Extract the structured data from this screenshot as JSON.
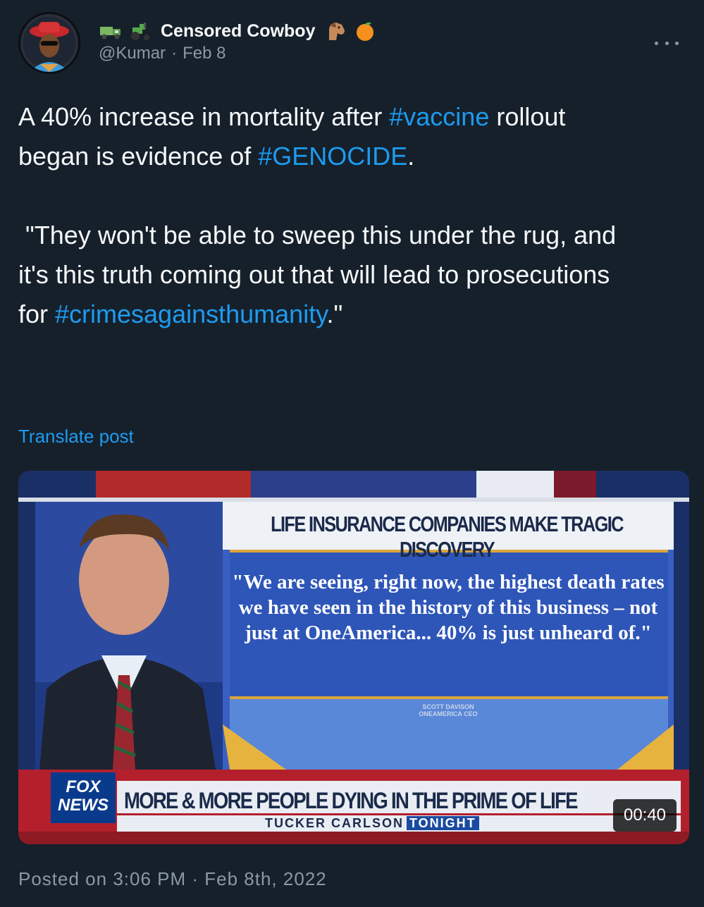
{
  "author": {
    "display_name": "Censored Cowboy",
    "handle": "@Kumar",
    "date": "Feb 8",
    "separator": "·",
    "name_emojis_left": [
      "truck-emoji",
      "tractor-emoji"
    ],
    "name_emojis_right": [
      "horse-face-emoji",
      "tangerine-emoji"
    ]
  },
  "tweet": {
    "segments": [
      {
        "text": "A 40% increase in mortality after ",
        "type": "text"
      },
      {
        "text": "#vaccine",
        "type": "hashtag"
      },
      {
        "text": " rollout\nbegan is evidence of ",
        "type": "text"
      },
      {
        "text": "#GENOCIDE",
        "type": "hashtag"
      },
      {
        "text": ".\n\n \"They won't be able to sweep this under the rug, and\nit's this truth coming out that will lead to prosecutions\nfor ",
        "type": "text"
      },
      {
        "text": "#crimesagainsthumanity",
        "type": "hashtag"
      },
      {
        "text": ".\"",
        "type": "text"
      }
    ],
    "translate_label": "Translate post"
  },
  "media": {
    "headline": "LIFE INSURANCE COMPANIES MAKE TRAGIC DISCOVERY",
    "quote": "\"We are seeing, right now, the highest death rates we have seen in the history of this business – not just at OneAmerica... 40% is just unheard of.\"",
    "attribution_line1": "SCOTT DAVISON",
    "attribution_line2": "ONEAMERICA CEO",
    "chyron": "MORE & MORE PEOPLE DYING IN THE PRIME OF LIFE",
    "show_name": "TUCKER CARLSON",
    "show_tag": "TONIGHT",
    "logo_line1": "FOX",
    "logo_line2": "NEWS",
    "duration": "00:40"
  },
  "footer": {
    "posted": "Posted on 3:06 PM · Feb 8th, 2022"
  },
  "colors": {
    "background": "#15202b",
    "link": "#1d9bf0",
    "secondary_text": "#8b98a5"
  }
}
